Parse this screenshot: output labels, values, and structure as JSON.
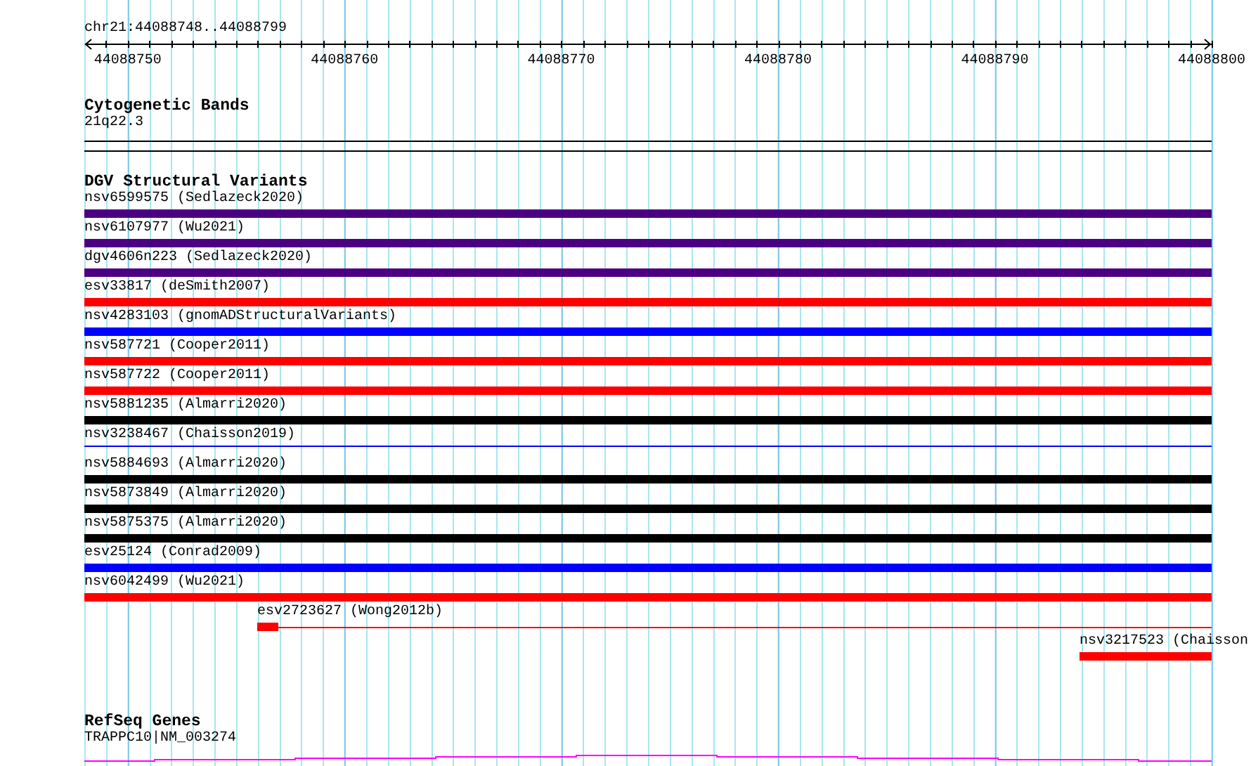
{
  "ruler": {
    "location": "chr21:44088748..44088799",
    "ticks": [
      "44088750",
      "44088760",
      "44088770",
      "44088780",
      "44088790",
      "44088800"
    ]
  },
  "tracks": [
    {
      "kind": "bands",
      "title": "Cytogenetic Bands",
      "features": [
        {
          "label": "21q22.3"
        }
      ]
    },
    {
      "kind": "variants",
      "title": "DGV Structural Variants",
      "features": [
        {
          "label": "nsv6599575 (Sedlazeck2020)",
          "kind": "full",
          "color": "#4b0082"
        },
        {
          "label": "nsv6107977 (Wu2021)",
          "kind": "full",
          "color": "#4b0082"
        },
        {
          "label": "dgv4606n223 (Sedlazeck2020)",
          "kind": "full",
          "color": "#4b0082"
        },
        {
          "label": "esv33817 (deSmith2007)",
          "kind": "full",
          "color": "#ff0000"
        },
        {
          "label": "nsv4283103 (gnomADStructuralVariants)",
          "kind": "full",
          "color": "#0000ff"
        },
        {
          "label": "nsv587721 (Cooper2011)",
          "kind": "full",
          "color": "#ff0000"
        },
        {
          "label": "nsv587722 (Cooper2011)",
          "kind": "full",
          "color": "#ff0000"
        },
        {
          "label": "nsv5881235 (Almarri2020)",
          "kind": "full",
          "color": "#000000"
        },
        {
          "label": "nsv3238467 (Chaisson2019)",
          "kind": "thin",
          "color": "#0000ff"
        },
        {
          "label": "nsv5884693 (Almarri2020)",
          "kind": "full",
          "color": "#000000"
        },
        {
          "label": "nsv5873849 (Almarri2020)",
          "kind": "full",
          "color": "#000000"
        },
        {
          "label": "nsv5875375 (Almarri2020)",
          "kind": "full",
          "color": "#000000"
        },
        {
          "label": "esv25124 (Conrad2009)",
          "kind": "full",
          "color": "#0000ff"
        },
        {
          "label": "nsv6042499 (Wu2021)",
          "kind": "full",
          "color": "#ff0000"
        },
        {
          "label": "esv2723627 (Wong2012b)",
          "kind": "left",
          "color": "#ff0000"
        },
        {
          "label": "nsv3217523 (Chaisson",
          "kind": "right",
          "color": "#ff0000"
        }
      ]
    },
    {
      "kind": "genes",
      "title": "RefSeq Genes",
      "features": [
        {
          "label": "TRAPPC10|NM_003274"
        }
      ]
    }
  ]
}
